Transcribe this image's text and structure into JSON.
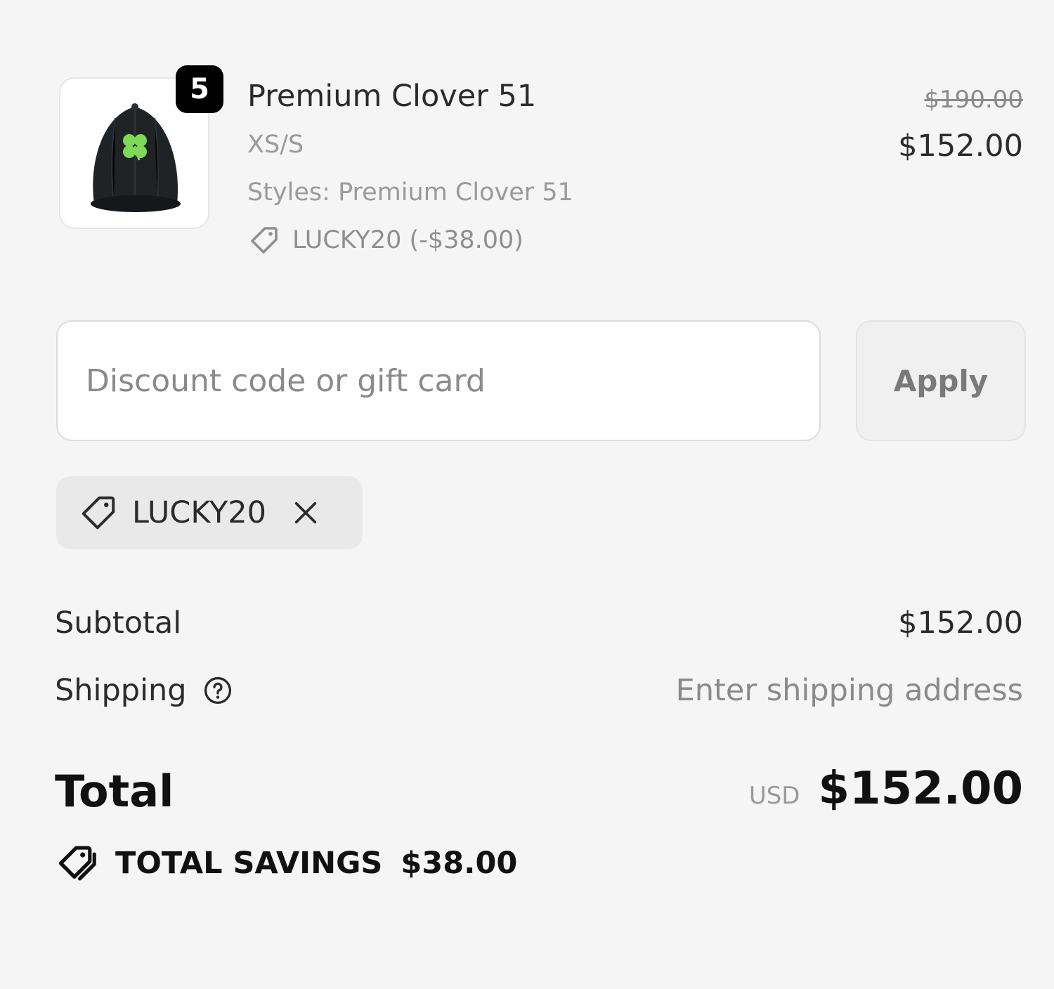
{
  "line_item": {
    "quantity": "5",
    "name": "Premium Clover 51",
    "variant": "XS/S",
    "styles": "Styles: Premium Clover 51",
    "discount": "LUCKY20 (-$38.00)",
    "compare_price": "$190.00",
    "price": "$152.00",
    "image_icon": "cap-with-clover-image"
  },
  "discount_form": {
    "placeholder": "Discount code or gift card",
    "value": "",
    "apply_label": "Apply"
  },
  "applied_code": {
    "code": "LUCKY20",
    "tag_icon": "tag-icon",
    "remove_icon": "close-icon"
  },
  "summary": {
    "subtotal_label": "Subtotal",
    "subtotal_value": "$152.00",
    "shipping_label": "Shipping",
    "shipping_help_icon": "help-circle-icon",
    "shipping_value": "Enter shipping address",
    "total_label": "Total",
    "total_currency": "USD",
    "total_value": "$152.00",
    "savings_label": "TOTAL SAVINGS",
    "savings_value": "$38.00",
    "savings_icon": "tags-icon"
  },
  "colors": {
    "background": "#f5f5f5",
    "text_primary": "#111111",
    "text_muted": "#8a8a8a",
    "badge_bg": "#000000",
    "clover_green": "#7ed957"
  }
}
